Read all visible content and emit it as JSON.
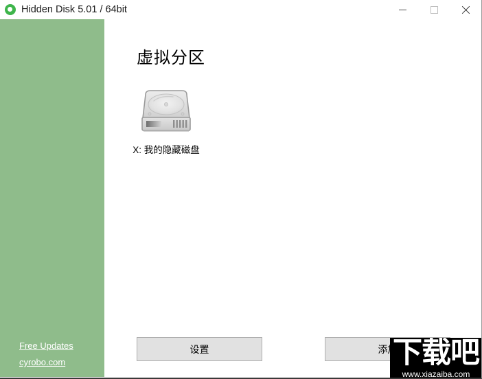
{
  "window": {
    "title": "Hidden Disk 5.01 / 64bit",
    "icon": "app-logo-icon",
    "controls": {
      "minimize": "minimize-icon",
      "maximize": "maximize-icon",
      "close": "close-icon"
    }
  },
  "theme": {
    "sidebar_bg": "#8fbc8b",
    "accent_green": "#3eb54b",
    "button_bg": "#e1e1e1",
    "button_border": "#adadad",
    "content_bg": "#ffffff",
    "link_color": "#ffffff"
  },
  "sidebar": {
    "links": [
      {
        "label": "Free Updates"
      },
      {
        "label": "cyrobo.com"
      }
    ]
  },
  "main": {
    "title": "虚拟分区",
    "disks": [
      {
        "icon": "hard-disk-icon",
        "label": "X: 我的隐藏磁盘"
      }
    ]
  },
  "footer": {
    "settings_label": "设置",
    "add_label": "添加"
  },
  "watermark": {
    "text": "下载吧",
    "url": "www.xiazaiba.com"
  }
}
